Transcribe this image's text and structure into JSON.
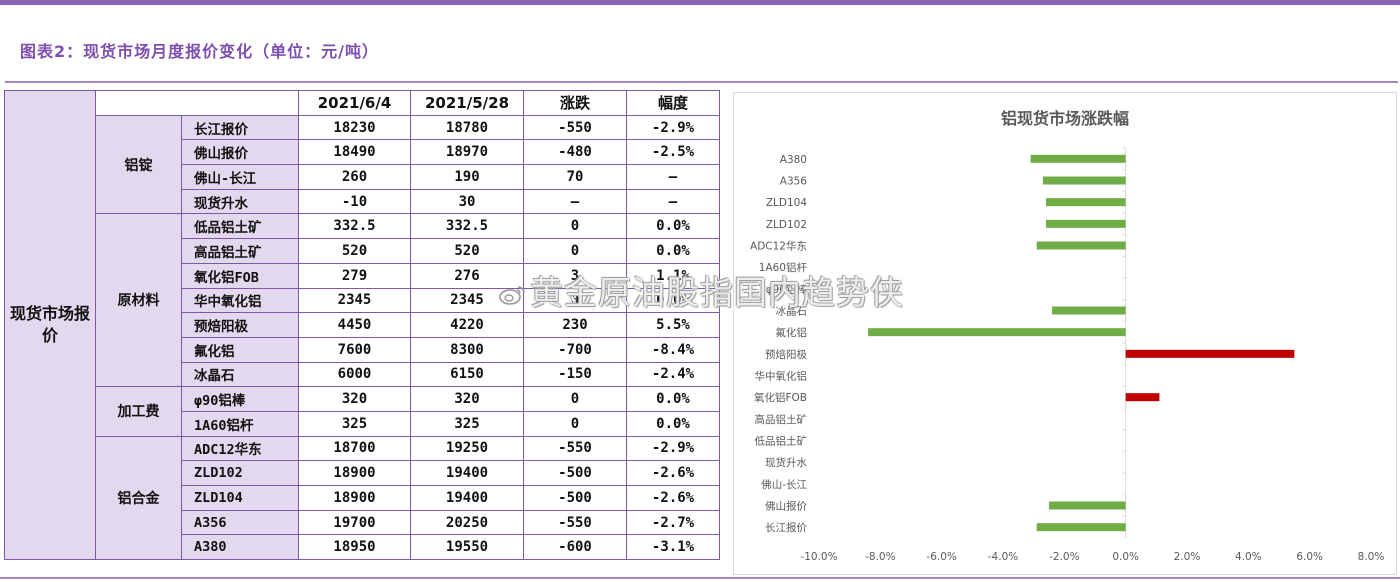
{
  "title": "图表2：现货市场月度报价变化（单位：元/吨）",
  "table": {
    "main_label": "现货市场报价",
    "headers": [
      "2021/6/4",
      "2021/5/28",
      "涨跌",
      "幅度"
    ],
    "sections": [
      {
        "name": "铝锭",
        "rows": [
          {
            "name": "长江报价",
            "v1": "18230",
            "v2": "18780",
            "chg": "-550",
            "pct": "-2.9%"
          },
          {
            "name": "佛山报价",
            "v1": "18490",
            "v2": "18970",
            "chg": "-480",
            "pct": "-2.5%"
          },
          {
            "name": "佛山-长江",
            "v1": "260",
            "v2": "190",
            "chg": "70",
            "pct": "—"
          },
          {
            "name": "现货升水",
            "v1": "-10",
            "v2": "30",
            "chg": "—",
            "pct": "—"
          }
        ]
      },
      {
        "name": "原材料",
        "rows": [
          {
            "name": "低品铝土矿",
            "v1": "332.5",
            "v2": "332.5",
            "chg": "0",
            "pct": "0.0%"
          },
          {
            "name": "高品铝土矿",
            "v1": "520",
            "v2": "520",
            "chg": "0",
            "pct": "0.0%"
          },
          {
            "name": "氧化铝FOB",
            "v1": "279",
            "v2": "276",
            "chg": "3",
            "pct": "1.1%"
          },
          {
            "name": "华中氧化铝",
            "v1": "2345",
            "v2": "2345",
            "chg": "0",
            "pct": "0.0%"
          },
          {
            "name": "预焙阳极",
            "v1": "4450",
            "v2": "4220",
            "chg": "230",
            "pct": "5.5%"
          },
          {
            "name": "氟化铝",
            "v1": "7600",
            "v2": "8300",
            "chg": "-700",
            "pct": "-8.4%"
          },
          {
            "name": "冰晶石",
            "v1": "6000",
            "v2": "6150",
            "chg": "-150",
            "pct": "-2.4%"
          }
        ]
      },
      {
        "name": "加工费",
        "rows": [
          {
            "name": "φ90铝棒",
            "v1": "320",
            "v2": "320",
            "chg": "0",
            "pct": "0.0%"
          },
          {
            "name": "1A60铝杆",
            "v1": "325",
            "v2": "325",
            "chg": "0",
            "pct": "0.0%"
          }
        ]
      },
      {
        "name": "铝合金",
        "rows": [
          {
            "name": "ADC12华东",
            "v1": "18700",
            "v2": "19250",
            "chg": "-550",
            "pct": "-2.9%"
          },
          {
            "name": "ZLD102",
            "v1": "18900",
            "v2": "19400",
            "chg": "-500",
            "pct": "-2.6%"
          },
          {
            "name": "ZLD104",
            "v1": "18900",
            "v2": "19400",
            "chg": "-500",
            "pct": "-2.6%"
          },
          {
            "name": "A356",
            "v1": "19700",
            "v2": "20250",
            "chg": "-550",
            "pct": "-2.7%"
          },
          {
            "name": "A380",
            "v1": "18950",
            "v2": "19550",
            "chg": "-600",
            "pct": "-3.1%"
          }
        ]
      }
    ]
  },
  "chart_data": {
    "type": "bar",
    "orientation": "horizontal",
    "title": "铝现货市场涨跌幅",
    "categories": [
      "A380",
      "A356",
      "ZLD104",
      "ZLD102",
      "ADC12华东",
      "1A60铝杆",
      "φ90铝棒",
      "冰晶石",
      "氟化铝",
      "预焙阳极",
      "华中氧化铝",
      "氧化铝FOB",
      "高品铝土矿",
      "低品铝土矿",
      "现货升水",
      "佛山-长江",
      "佛山报价",
      "长江报价"
    ],
    "values": [
      -3.1,
      -2.7,
      -2.6,
      -2.6,
      -2.9,
      0.0,
      0.0,
      -2.4,
      -8.4,
      5.5,
      0.0,
      1.1,
      0.0,
      0.0,
      null,
      null,
      -2.5,
      -2.9
    ],
    "xlim": [
      -10,
      8
    ],
    "xticks": [
      "-10.0%",
      "-8.0%",
      "-6.0%",
      "-4.0%",
      "-2.0%",
      "0.0%",
      "2.0%",
      "4.0%",
      "6.0%",
      "8.0%"
    ],
    "tick_values": [
      -10,
      -8,
      -6,
      -4,
      -2,
      0,
      2,
      4,
      6,
      8
    ],
    "colors": {
      "negative": "#70ad47",
      "positive": "#c00000",
      "axis": "#d9d9d9",
      "label": "#595959"
    }
  },
  "watermark": "黄金原油股指国内趋势侠"
}
